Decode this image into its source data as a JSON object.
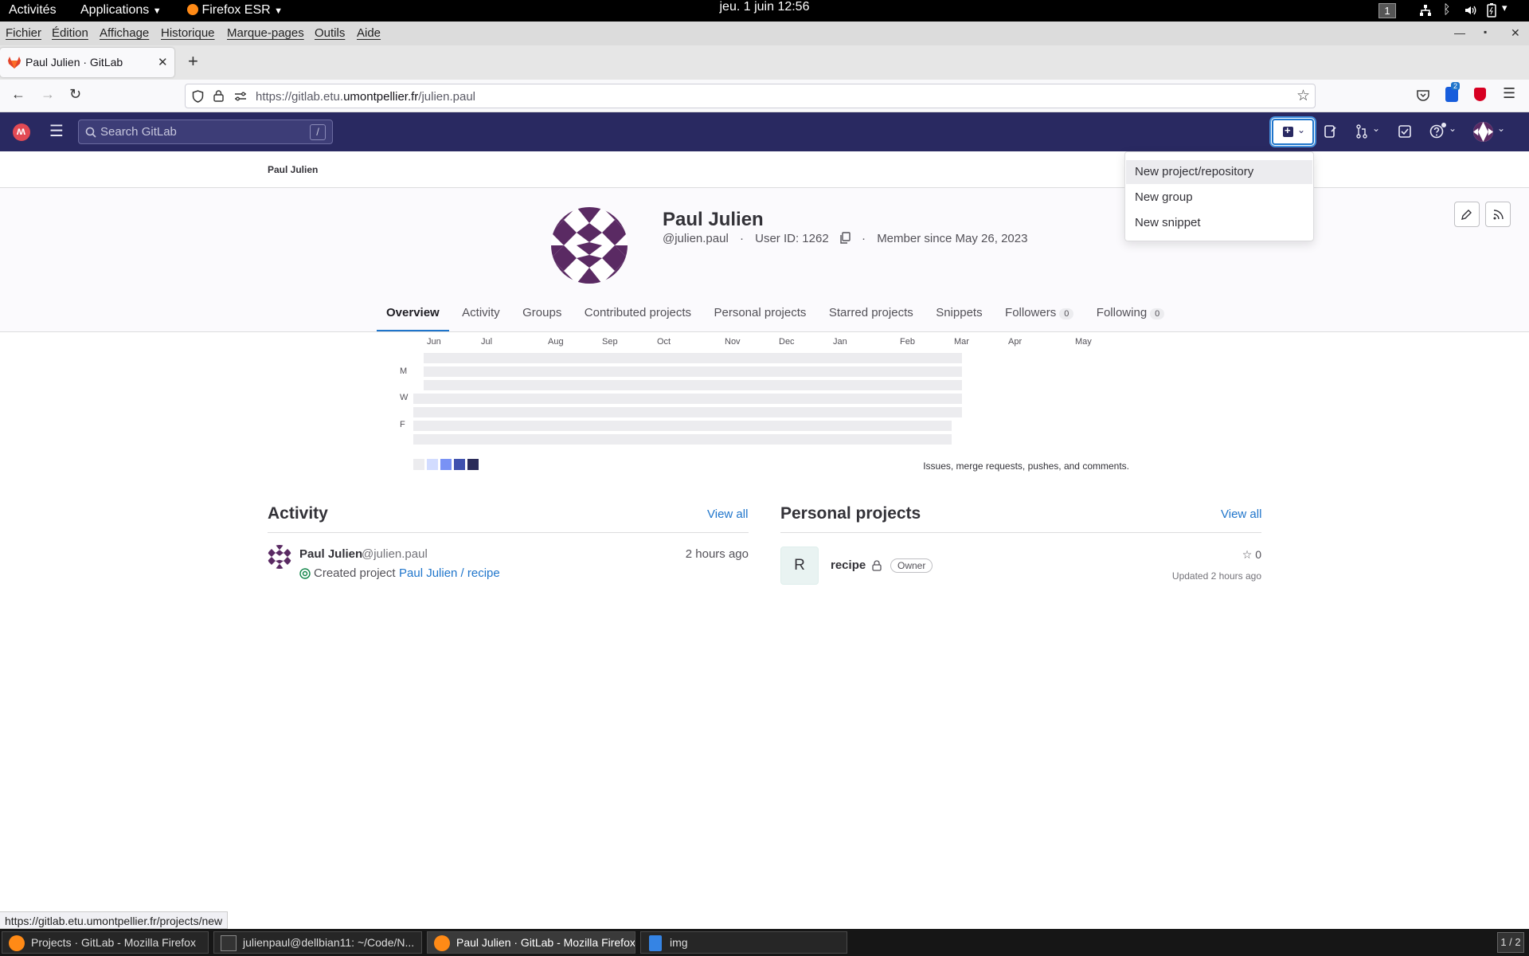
{
  "system_bar": {
    "activities": "Activités",
    "applications": "Applications",
    "firefox": "Firefox ESR",
    "clock": "jeu. 1 juin  12:56",
    "workspace": "1"
  },
  "menu": [
    "Fichier",
    "Édition",
    "Affichage",
    "Historique",
    "Marque-pages",
    "Outils",
    "Aide"
  ],
  "browser_tab": {
    "title": "Paul Julien · GitLab"
  },
  "url": {
    "prefix": "https://gitlab.etu.",
    "domain": "umontpellier.fr",
    "path": "/julien.paul"
  },
  "extension_badge": "2",
  "gitlab": {
    "search_placeholder": "Search GitLab",
    "search_shortcut": "/",
    "breadcrumb": "Paul Julien",
    "dropdown": [
      "New project/repository",
      "New group",
      "New snippet"
    ]
  },
  "profile": {
    "name": "Paul Julien",
    "username": "@julien.paul",
    "user_id": "User ID: 1262",
    "member_since": "Member since May 26, 2023",
    "separator": "·"
  },
  "tabs": [
    {
      "label": "Overview",
      "active": true
    },
    {
      "label": "Activity"
    },
    {
      "label": "Groups"
    },
    {
      "label": "Contributed projects"
    },
    {
      "label": "Personal projects"
    },
    {
      "label": "Starred projects"
    },
    {
      "label": "Snippets"
    },
    {
      "label": "Followers",
      "count": "0"
    },
    {
      "label": "Following",
      "count": "0"
    }
  ],
  "calendar": {
    "months": [
      "Jun",
      "Jul",
      "Aug",
      "Sep",
      "Oct",
      "Nov",
      "Dec",
      "Jan",
      "Feb",
      "Mar",
      "Apr",
      "May"
    ],
    "days": [
      "M",
      "W",
      "F"
    ],
    "legend_colors": [
      "#ececef",
      "#d2dcff",
      "#7992f5",
      "#3f51ae",
      "#2a2b59"
    ],
    "empty_color": "#ececef",
    "note": "Issues, merge requests, pushes, and comments."
  },
  "activity": {
    "title": "Activity",
    "view_all": "View all",
    "items": [
      {
        "author": "Paul Julien",
        "handle": "@julien.paul",
        "time": "2 hours ago",
        "action": "Created project",
        "target": "Paul Julien / recipe"
      }
    ]
  },
  "personal_projects": {
    "title": "Personal projects",
    "view_all": "View all",
    "items": [
      {
        "initial": "R",
        "name": "recipe",
        "role": "Owner",
        "stars": "0",
        "updated": "Updated 2 hours ago"
      }
    ]
  },
  "status_link": "https://gitlab.etu.umontpellier.fr/projects/new",
  "taskbar": [
    {
      "label": "Projects · GitLab - Mozilla Firefox",
      "icon": "firefox-icon"
    },
    {
      "label": "julienpaul@dellbian11: ~/Code/N...",
      "icon": "terminal-icon"
    },
    {
      "label": "Paul Julien · GitLab - Mozilla Firefox",
      "icon": "firefox-icon",
      "active": true
    },
    {
      "label": "img",
      "icon": "file-icon"
    }
  ],
  "pager": "1 / 2",
  "colors": {
    "gitlab_header": "#292961",
    "link": "#1f75cb",
    "avatar": "#5a2a63"
  }
}
